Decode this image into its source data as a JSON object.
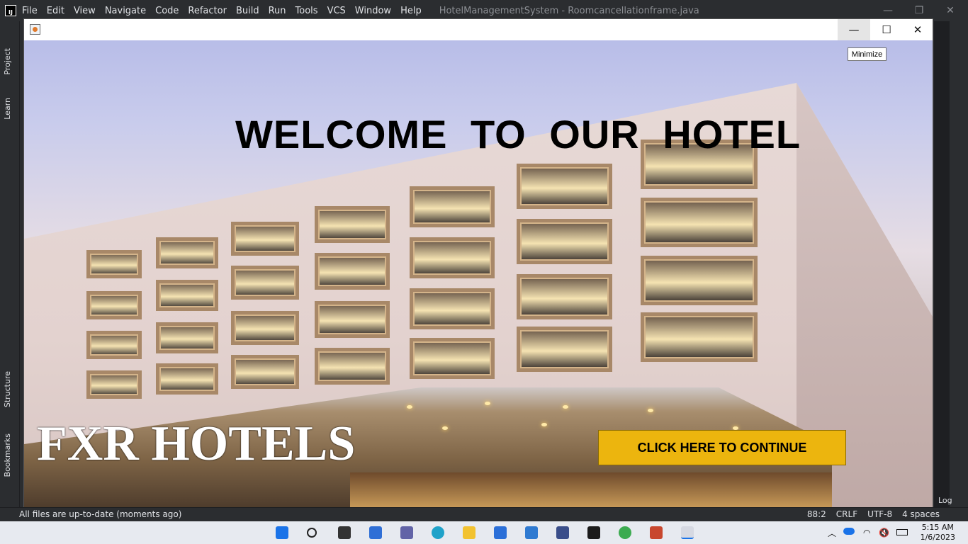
{
  "ide": {
    "logo": "IJ",
    "menu": [
      "File",
      "Edit",
      "View",
      "Navigate",
      "Code",
      "Refactor",
      "Build",
      "Run",
      "Tools",
      "VCS",
      "Window",
      "Help"
    ],
    "file_title": "HotelManagementSystem - Roomcancellationframe.java",
    "left_tabs": [
      "Project",
      "Learn",
      "Structure",
      "Bookmarks"
    ],
    "status_message": "All files are up-to-date (moments ago)",
    "status_right": [
      "88:2",
      "CRLF",
      "UTF-8",
      "4 spaces"
    ],
    "right_tab": "Log"
  },
  "frame": {
    "welcome_text": "WELCOME TO OUR HOTEL",
    "brand_text": "FXR HOTELS",
    "continue_label": "CLICK HERE TO CONTINUE",
    "tooltip": "Minimize",
    "controls": {
      "minimize": "—",
      "maximize": "☐",
      "close": "✕"
    }
  },
  "taskbar": {
    "time": "5:15 AM",
    "date": "1/6/2023",
    "icons": [
      "windows-start-icon",
      "search-icon",
      "file-explorer-icon",
      "widgets-icon",
      "teams-chat-icon",
      "edge-icon",
      "folder-icon",
      "mail-icon",
      "store-icon",
      "app-icon",
      "intellij-icon",
      "chrome-icon",
      "java-icon"
    ]
  }
}
